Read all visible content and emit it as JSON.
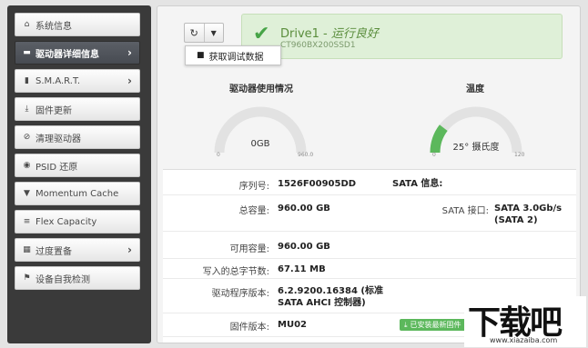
{
  "sidebar": {
    "items": [
      {
        "label": "系统信息",
        "icon": "home-icon",
        "active": false,
        "chevron": false
      },
      {
        "label": "驱动器详细信息",
        "icon": "drive-icon",
        "active": true,
        "chevron": true
      },
      {
        "label": "S.M.A.R.T.",
        "icon": "bar-chart-icon",
        "active": false,
        "chevron": true
      },
      {
        "label": "固件更新",
        "icon": "download-icon",
        "active": false,
        "chevron": false
      },
      {
        "label": "清理驱动器",
        "icon": "ban-icon",
        "active": false,
        "chevron": false
      },
      {
        "label": "PSID 还原",
        "icon": "eye-slash-icon",
        "active": false,
        "chevron": false
      },
      {
        "label": "Momentum Cache",
        "icon": "filter-icon",
        "active": false,
        "chevron": false
      },
      {
        "label": "Flex Capacity",
        "icon": "list-icon",
        "active": false,
        "chevron": false
      },
      {
        "label": "过度置备",
        "icon": "grid-icon",
        "active": false,
        "chevron": true
      },
      {
        "label": "设备自我检测",
        "icon": "flag-icon",
        "active": false,
        "chevron": false
      }
    ]
  },
  "toolbar": {
    "refresh_icon": "refresh-icon",
    "dropdown_icon": "caret-down-icon",
    "menu_item_label": "获取调试数据",
    "menu_item_icon": "briefcase-icon"
  },
  "status": {
    "drive_name": "Drive1 - ",
    "state": "运行良好",
    "model": "CT960BX200SSD1",
    "color": "#47a447"
  },
  "gauges": {
    "usage": {
      "title": "驱动器使用情况",
      "value_text": "0GB",
      "min": "0",
      "max": "960.0",
      "fraction": 0.0
    },
    "temperature": {
      "title": "温度",
      "value_text": "25° 摄氏度",
      "min": "0",
      "max": "120",
      "fraction": 0.208,
      "color": "#5cb85c"
    }
  },
  "info": {
    "serial_label": "序列号:",
    "serial_value": "1526F00905DD",
    "sata_info_label": "SATA 信息:",
    "capacity_label": "总容量:",
    "capacity_value": "960.00 GB",
    "sata_port_label": "SATA 接口:",
    "sata_port_value": "SATA 3.0Gb/s (SATA 2)",
    "available_label": "可用容量:",
    "available_value": "960.00 GB",
    "written_label": "写入的总字节数:",
    "written_value": "67.11 MB",
    "driver_label": "驱动程序版本:",
    "driver_value": "6.2.9200.16384 (标准 SATA AHCI 控制器)",
    "firmware_label": "固件版本:",
    "firmware_value": "MU02",
    "firmware_badge": "已安装最新固件"
  },
  "watermark": {
    "text": "下载吧",
    "url": "www.xiazaiba.com"
  }
}
